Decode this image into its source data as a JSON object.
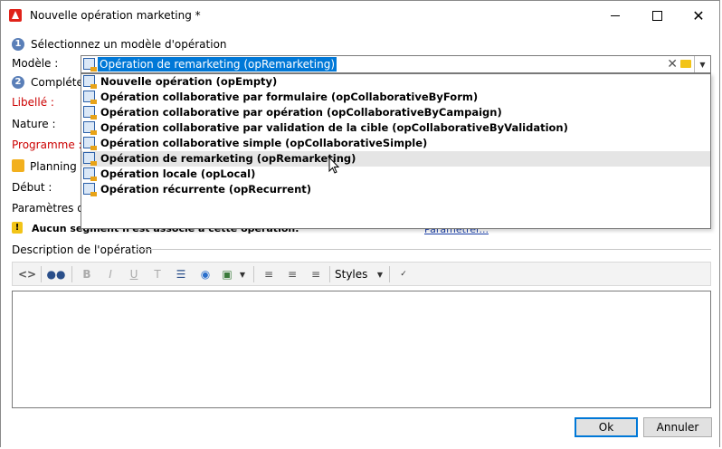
{
  "window": {
    "title": "Nouvelle opération marketing *"
  },
  "step1": {
    "number": "1",
    "label": "Sélectionnez un modèle d'opération"
  },
  "model": {
    "label": "Modèle :",
    "selected": "Opération de remarketing (opRemarketing)"
  },
  "step2": {
    "number": "2",
    "label": "Complétez"
  },
  "fields": {
    "libelle": "Libellé :",
    "nature": "Nature :",
    "programme": "Programme :",
    "planning": "Planning",
    "debut": "Début :",
    "parametres": "Paramètres de"
  },
  "dropdown": {
    "items": [
      {
        "label": "Nouvelle opération (opEmpty)",
        "highlighted": false
      },
      {
        "label": "Opération collaborative par formulaire (opCollaborativeByForm)",
        "highlighted": false
      },
      {
        "label": "Opération collaborative par opération (opCollaborativeByCampaign)",
        "highlighted": false
      },
      {
        "label": "Opération collaborative par validation de la cible (opCollaborativeByValidation)",
        "highlighted": false
      },
      {
        "label": "Opération collaborative simple (opCollaborativeSimple)",
        "highlighted": false
      },
      {
        "label": "Opération de remarketing (opRemarketing)",
        "highlighted": true
      },
      {
        "label": "Opération locale (opLocal)",
        "highlighted": false
      },
      {
        "label": "Opération récurrente (opRecurrent)",
        "highlighted": false
      }
    ]
  },
  "segment": {
    "warning_text": "Aucun segment n'est associé à cette opération.",
    "link": "Paramétrer..."
  },
  "description": {
    "label": "Description de l'opération"
  },
  "toolbar": {
    "styles_label": "Styles"
  },
  "buttons": {
    "ok": "Ok",
    "cancel": "Annuler"
  },
  "colors": {
    "selection": "#0078d7",
    "required": "#cc0000",
    "link": "#1a3fa8"
  }
}
